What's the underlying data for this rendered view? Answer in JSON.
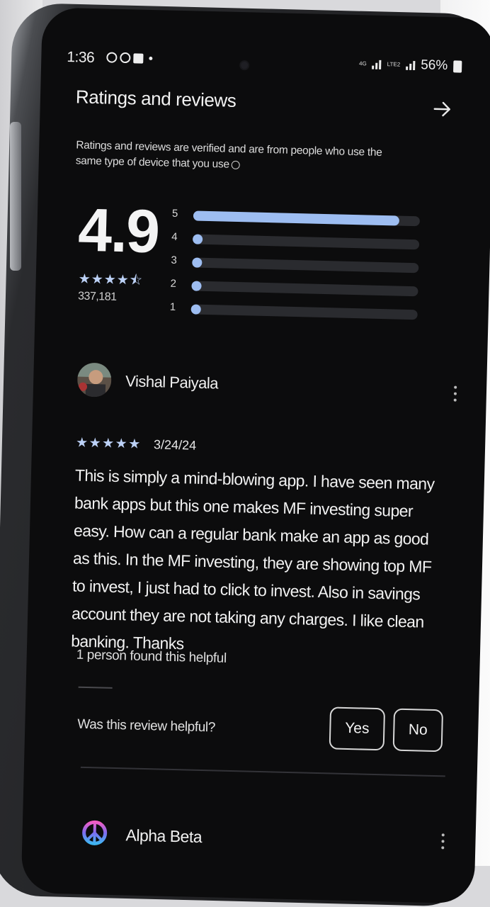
{
  "status_bar": {
    "time": "1:36",
    "network_primary": "4G",
    "network_secondary": "LTE2",
    "battery_text": "56%"
  },
  "section": {
    "title": "Ratings and reviews",
    "arrow_icon": "arrow-right-icon"
  },
  "verified_note": "Ratings and reviews are verified and are from people who use the same type of device that you use",
  "summary": {
    "score": "4.9",
    "stars_shown": 4.5,
    "review_count": "337,181"
  },
  "histogram": [
    {
      "label": "5",
      "fraction": 0.91
    },
    {
      "label": "4",
      "fraction": 0.03
    },
    {
      "label": "3",
      "fraction": 0.01
    },
    {
      "label": "2",
      "fraction": 0.01
    },
    {
      "label": "1",
      "fraction": 0.03
    }
  ],
  "review": {
    "reviewer_name": "Vishal Paiyala",
    "stars": 5,
    "date": "3/24/24",
    "text": "This is simply a mind-blowing app. I have seen many bank apps but this one makes MF investing super easy. How can a regular bank make an app as good as this. In the MF investing, they are showing top MF to invest, I just had to click to invest. Also in savings account they are not taking any charges. I like clean banking. Thanks",
    "helpful_count": "1 person found this helpful",
    "helpful_question": "Was this review helpful?",
    "yes_label": "Yes",
    "no_label": "No"
  },
  "next_review": {
    "reviewer_name": "Alpha Beta"
  },
  "colors": {
    "accent": "#9dbdf1",
    "background": "#0c0c0d",
    "track": "#2a2b2f"
  }
}
